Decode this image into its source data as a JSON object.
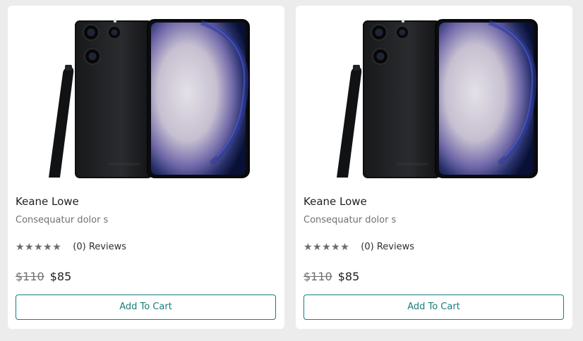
{
  "products": [
    {
      "image_alt": "Samsung phone with stylus",
      "title": "Keane Lowe",
      "description": "Consequatur dolor s",
      "rating": 0,
      "rating_max": 5,
      "stars_display": "★★★★★",
      "reviews_label": "(0) Reviews",
      "old_price": "$110",
      "new_price": "$85",
      "button_label": "Add To Cart",
      "accent_color": "#1b7c7c",
      "icon": "product-photo"
    },
    {
      "image_alt": "Samsung phone with stylus",
      "title": "Keane Lowe",
      "description": "Consequatur dolor s",
      "rating": 0,
      "rating_max": 5,
      "stars_display": "★★★★★",
      "reviews_label": "(0) Reviews",
      "old_price": "$110",
      "new_price": "$85",
      "button_label": "Add To Cart",
      "accent_color": "#1b7c7c",
      "icon": "product-photo"
    }
  ]
}
